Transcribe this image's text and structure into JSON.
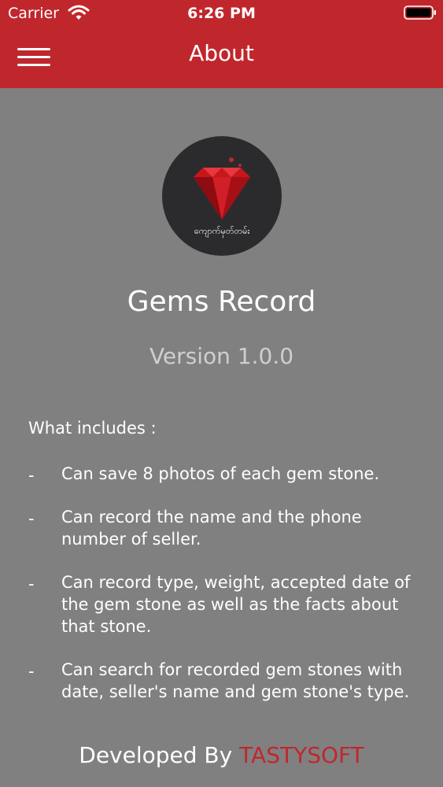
{
  "status_bar": {
    "carrier": "Carrier",
    "time": "6:26 PM",
    "icons": [
      "wifi-icon",
      "battery-icon"
    ]
  },
  "nav": {
    "title": "About",
    "menu_icon": "hamburger-menu-icon"
  },
  "logo": {
    "icon": "ruby-gem-icon",
    "caption": "ကျောက်မှတ်တမ်း"
  },
  "app": {
    "name": "Gems Record",
    "version": "Version 1.0.0"
  },
  "includes": {
    "heading": "What includes :",
    "bullet": "-",
    "items": [
      "Can save 8 photos of each gem stone.",
      "Can record the name and the phone number of seller.",
      "Can record type, weight, accepted date of the gem stone as well as the facts about that stone.",
      "Can search for recorded gem stones with date, seller's name and gem stone's type."
    ]
  },
  "footer": {
    "prefix": "Developed By ",
    "brand": "TASTYSOFT"
  },
  "colors": {
    "header_red": "#c0272d",
    "background_gray": "#808080",
    "logo_dark": "#2b2b2d",
    "version_text": "#cfcfcf"
  }
}
